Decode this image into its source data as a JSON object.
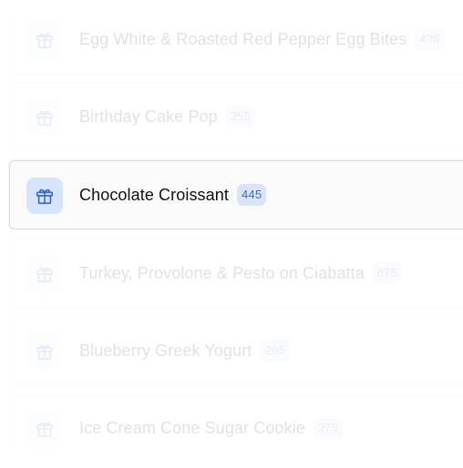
{
  "colors": {
    "accent": "#3a6ad0",
    "badge_bg": "#d8e4fb",
    "icon_bg": "#d6e4fc"
  },
  "items": [
    {
      "name": "Egg White & Roasted Red Pepper Egg Bites",
      "count": "4?6",
      "icon": "gift-icon"
    },
    {
      "name": "Birthday Cake Pop",
      "count": "355",
      "icon": "gift-icon"
    },
    {
      "name": "Chocolate Croissant",
      "count": "445",
      "icon": "gift-icon",
      "selected": true
    },
    {
      "name": "Turkey, Provolone & Pesto on Ciabatta",
      "count": "875",
      "icon": "gift-icon"
    },
    {
      "name": "Blueberry Greek Yogurt",
      "count": "295",
      "icon": "gift-icon"
    },
    {
      "name": "Ice Cream Cone Sugar Cookie",
      "count": "375",
      "icon": "gift-icon"
    }
  ]
}
